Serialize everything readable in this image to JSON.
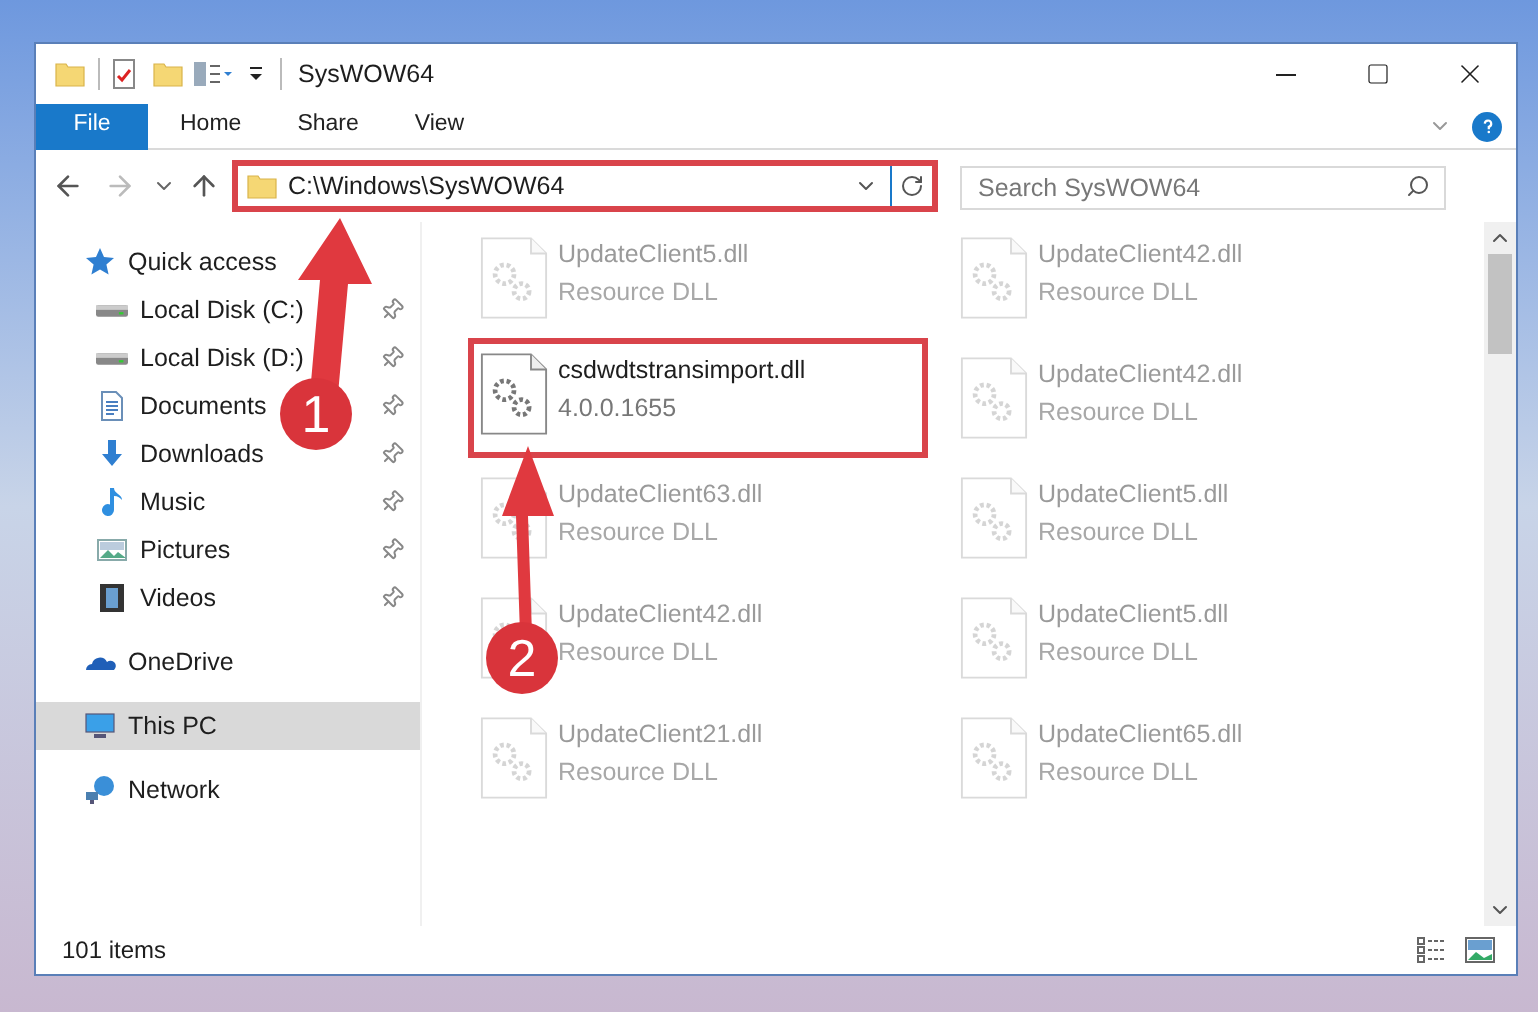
{
  "window": {
    "title": "SysWOW64"
  },
  "ribbon_tabs": [
    {
      "label": "File",
      "selected": true
    },
    {
      "label": "Home",
      "selected": false
    },
    {
      "label": "Share",
      "selected": false
    },
    {
      "label": "View",
      "selected": false
    }
  ],
  "address": {
    "value": "C:\\Windows\\SysWOW64",
    "highlighted": true
  },
  "search": {
    "placeholder": "Search SysWOW64"
  },
  "sidebar": {
    "items": [
      {
        "label": "Quick access",
        "kind": "star",
        "selected": false,
        "children": [
          {
            "label": "Local Disk (C:)",
            "kind": "drive",
            "pinned": true
          },
          {
            "label": "Local Disk (D:)",
            "kind": "drive",
            "pinned": true
          },
          {
            "label": "Documents",
            "kind": "documents",
            "pinned": true
          },
          {
            "label": "Downloads",
            "kind": "downloads",
            "pinned": true
          },
          {
            "label": "Music",
            "kind": "music",
            "pinned": true
          },
          {
            "label": "Pictures",
            "kind": "pictures",
            "pinned": true
          },
          {
            "label": "Videos",
            "kind": "videos",
            "pinned": true
          }
        ]
      },
      {
        "label": "OneDrive",
        "kind": "cloud",
        "selected": false
      },
      {
        "label": "This PC",
        "kind": "pc",
        "selected": true
      },
      {
        "label": "Network",
        "kind": "network",
        "selected": false
      }
    ]
  },
  "files": [
    {
      "name": "UpdateClient5.dll",
      "detail": "Resource DLL",
      "blurred": true,
      "highlighted": false
    },
    {
      "name": "UpdateClient42.dll",
      "detail": "Resource DLL",
      "blurred": true,
      "highlighted": false
    },
    {
      "name": "csdwdtstransimport.dll",
      "detail": "4.0.0.1655",
      "blurred": false,
      "highlighted": true
    },
    {
      "name": "UpdateClient42.dll",
      "detail": "Resource DLL",
      "blurred": true,
      "highlighted": false
    },
    {
      "name": "UpdateClient63.dll",
      "detail": "Resource DLL",
      "blurred": true,
      "highlighted": false
    },
    {
      "name": "UpdateClient5.dll",
      "detail": "Resource DLL",
      "blurred": true,
      "highlighted": false
    },
    {
      "name": "UpdateClient42.dll",
      "detail": "Resource DLL",
      "blurred": true,
      "highlighted": false
    },
    {
      "name": "UpdateClient5.dll",
      "detail": "Resource DLL",
      "blurred": true,
      "highlighted": false
    },
    {
      "name": "UpdateClient21.dll",
      "detail": "Resource DLL",
      "blurred": true,
      "highlighted": false
    },
    {
      "name": "UpdateClient65.dll",
      "detail": "Resource DLL",
      "blurred": true,
      "highlighted": false
    }
  ],
  "annotations": [
    {
      "label": "1"
    },
    {
      "label": "2"
    }
  ],
  "status_bar": {
    "item_count": "101 items"
  }
}
